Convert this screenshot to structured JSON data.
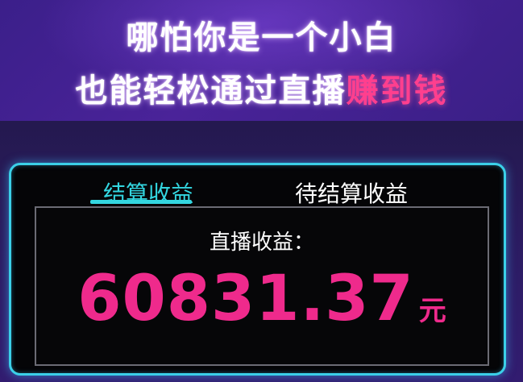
{
  "headline": {
    "line1": "哪怕你是一个小白",
    "line2_main": "也能轻松通过直播",
    "line2_highlight": "赚到钱"
  },
  "tabs": [
    {
      "label": "结算收益",
      "active": true
    },
    {
      "label": "待结算收益",
      "active": false
    }
  ],
  "earnings": {
    "label": "直播收益：",
    "amount": "60831.37",
    "unit": "元"
  },
  "colors": {
    "accent_cyan": "#33d6e0",
    "amount_pink": "#ef2a8c",
    "highlight_pink": "#ff3f8e",
    "background_purple": "#3b1f8a"
  }
}
